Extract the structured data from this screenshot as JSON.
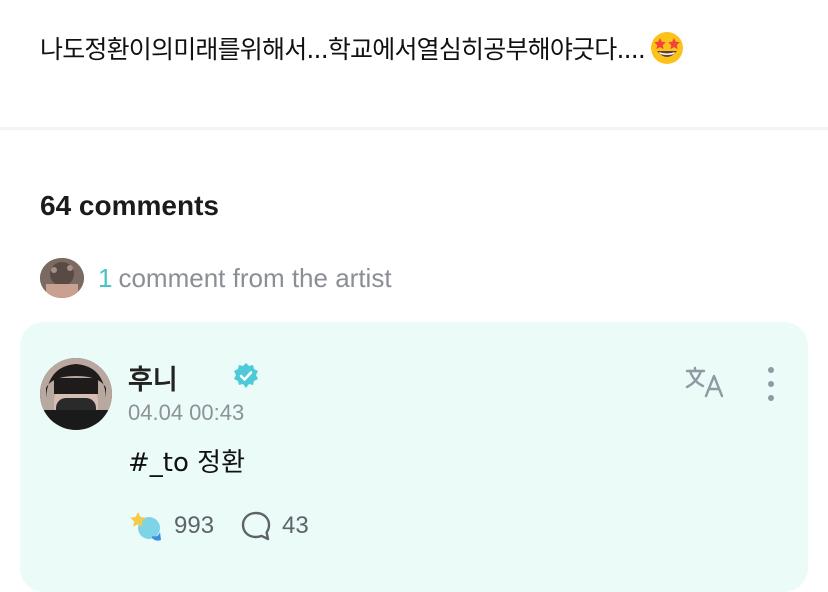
{
  "post": {
    "text": "나도정환이의미래를위해서...학교에서열심히공부해야긋다....",
    "emoji": "star-struck-emoji"
  },
  "comments": {
    "count_label": "64 comments",
    "artist_count": "1",
    "artist_label": "comment from the artist"
  },
  "comment": {
    "author": "후니",
    "timestamp": "04.04 00:43",
    "text": "#_to 정환",
    "likes": "993",
    "replies": "43"
  },
  "colors": {
    "accent": "#4cc3c4",
    "card_bg": "#eafbf8",
    "verified": "#4ec9d8"
  },
  "icons": [
    "star-struck-emoji",
    "verified-badge-icon",
    "translate-icon",
    "more-vertical-icon",
    "like-icon",
    "comment-icon"
  ]
}
